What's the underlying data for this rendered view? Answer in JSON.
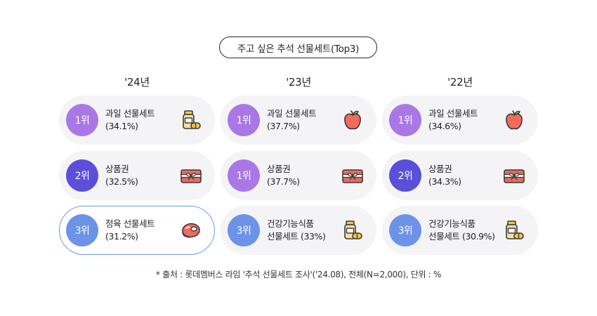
{
  "title": "주고 싶은 추석 선물세트(Top3)",
  "footnote": "* 출처 : 롯데멤버스 라임 '추석 선물세트 조사'('24.08), 전체(N=2,000), 단위 : %",
  "colors": {
    "rank1": "#a978e6",
    "rank2": "#5b4fd9",
    "rank3": "#6d93e8",
    "card_bg": "#f4f4f6",
    "highlight_border": "#6f9ae8"
  },
  "chart_data": {
    "type": "table",
    "title": "주고 싶은 추석 선물세트(Top3)",
    "unit": "%",
    "columns": [
      {
        "year": "'24년",
        "items": [
          {
            "rank_label": "1위",
            "rank_color": "rank1",
            "line1": "과일 선물세트",
            "line2": "(34.1%)",
            "value": 34.1,
            "icon": "jar-icon"
          },
          {
            "rank_label": "2위",
            "rank_color": "rank2",
            "line1": "상품권",
            "line2": "(32.5%)",
            "value": 32.5,
            "icon": "gift-card-icon"
          },
          {
            "rank_label": "3위",
            "rank_color": "rank3",
            "line1": "정육 선물세트",
            "line2": "(31.2%)",
            "value": 31.2,
            "icon": "meat-icon",
            "highlight": true
          }
        ]
      },
      {
        "year": "'23년",
        "items": [
          {
            "rank_label": "1위",
            "rank_color": "rank1",
            "line1": "과일 선물세트",
            "line2": "(37.7%)",
            "value": 37.7,
            "icon": "apple-icon"
          },
          {
            "rank_label": "1위",
            "rank_color": "rank1",
            "line1": "상품권",
            "line2": "(37.7%)",
            "value": 37.7,
            "icon": "gift-card-icon"
          },
          {
            "rank_label": "3위",
            "rank_color": "rank3",
            "line1": "건강기능식품",
            "line2": "선물세트 (33%)",
            "value": 33,
            "icon": "jar-icon"
          }
        ]
      },
      {
        "year": "'22년",
        "items": [
          {
            "rank_label": "1위",
            "rank_color": "rank1",
            "line1": "과일 선물세트",
            "line2": "(34.6%)",
            "value": 34.6,
            "icon": "apple-icon"
          },
          {
            "rank_label": "2위",
            "rank_color": "rank2",
            "line1": "상품권",
            "line2": "(34.3%)",
            "value": 34.3,
            "icon": "gift-card-icon"
          },
          {
            "rank_label": "3위",
            "rank_color": "rank3",
            "line1": "건강기능식품",
            "line2": "선물세트 (30.9%)",
            "value": 30.9,
            "icon": "jar-icon"
          }
        ]
      }
    ]
  }
}
